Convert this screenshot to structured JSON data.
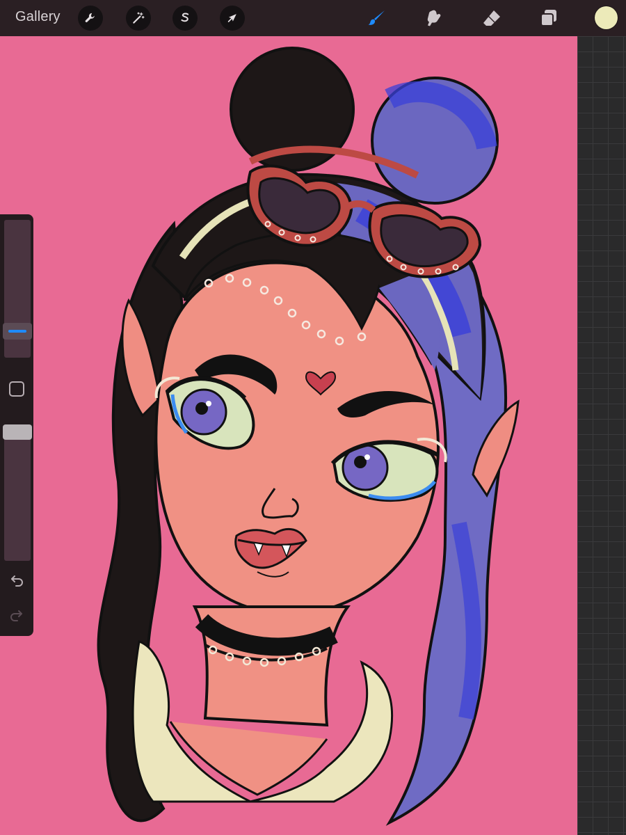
{
  "app": {
    "gallery_label": "Gallery"
  },
  "toolbar": {
    "left_tools": [
      {
        "name": "wrench-icon",
        "role": "actions"
      },
      {
        "name": "magic-wand-icon",
        "role": "adjustments"
      },
      {
        "name": "selection-s-icon",
        "role": "selection"
      },
      {
        "name": "transform-arrow-icon",
        "role": "transform"
      }
    ],
    "right_tools": [
      {
        "name": "brush-icon",
        "role": "paint",
        "active": true
      },
      {
        "name": "smudge-icon",
        "role": "smudge"
      },
      {
        "name": "eraser-icon",
        "role": "erase"
      },
      {
        "name": "layers-icon",
        "role": "layers"
      }
    ],
    "active_color": "#eceab9",
    "accent_color": "#1e8bff"
  },
  "sidebar": {
    "brush_size_level": 0.15,
    "opacity_level": 1.0,
    "modify_icon": "square-icon",
    "undo_icon": "undo-arrow-icon",
    "redo_icon": "redo-arrow-icon"
  },
  "canvas": {
    "background_color": "#e86a94",
    "subject": "illustration-girl-portrait"
  }
}
